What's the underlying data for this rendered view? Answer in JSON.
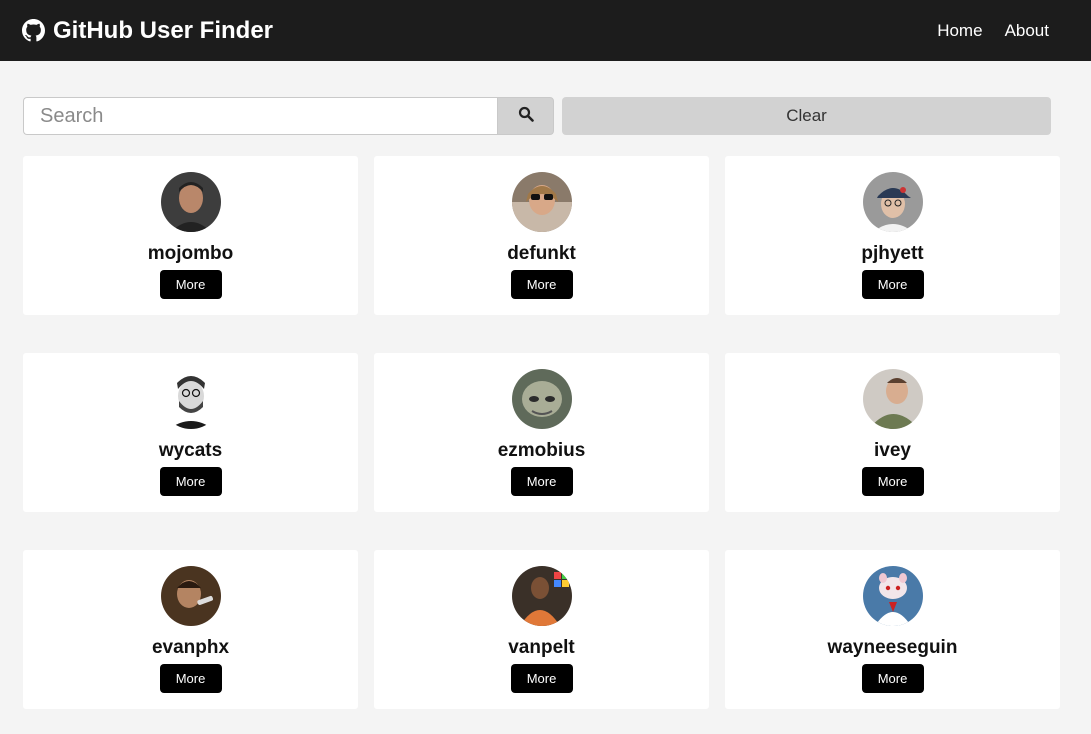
{
  "navbar": {
    "brand_icon": "github-icon",
    "title": "GitHub User Finder",
    "links": [
      "Home",
      "About"
    ]
  },
  "search": {
    "placeholder": "Search",
    "value": "",
    "search_icon": "search-icon",
    "clear_label": "Clear"
  },
  "users": [
    {
      "login": "mojombo",
      "more": "More"
    },
    {
      "login": "defunkt",
      "more": "More"
    },
    {
      "login": "pjhyett",
      "more": "More"
    },
    {
      "login": "wycats",
      "more": "More"
    },
    {
      "login": "ezmobius",
      "more": "More"
    },
    {
      "login": "ivey",
      "more": "More"
    },
    {
      "login": "evanphx",
      "more": "More"
    },
    {
      "login": "vanpelt",
      "more": "More"
    },
    {
      "login": "wayneeseguin",
      "more": "More"
    }
  ],
  "colors": {
    "navbar": "#1c1c1c",
    "background": "#f4f4f4",
    "button_dark": "#000000",
    "button_light": "#d2d2d2"
  }
}
